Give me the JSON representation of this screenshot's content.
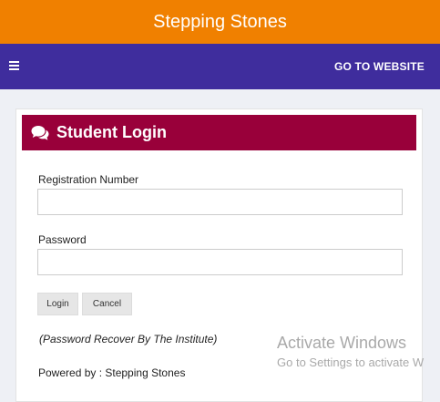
{
  "header": {
    "title": "Stepping Stones"
  },
  "navbar": {
    "menu_icon": "hamburger-menu-icon",
    "link_label": "GO TO WEBSITE"
  },
  "login_card": {
    "title": "Student Login",
    "title_icon": "comments-icon",
    "registration_label": "Registration Number",
    "registration_value": "",
    "password_label": "Password",
    "password_value": "",
    "login_button": "Login",
    "cancel_button": "Cancel",
    "recover_note": "(Password Recover By The Institute)",
    "powered_by_prefix": "Powered by : ",
    "powered_by_name": "Stepping Stones"
  },
  "watermark": {
    "line1": "Activate Windows",
    "line2": "Go to Settings to activate W"
  },
  "colors": {
    "header_bg": "#f08000",
    "navbar_bg": "#3f2d9d",
    "card_header_bg": "#99003a",
    "page_bg": "#eef0f5"
  }
}
